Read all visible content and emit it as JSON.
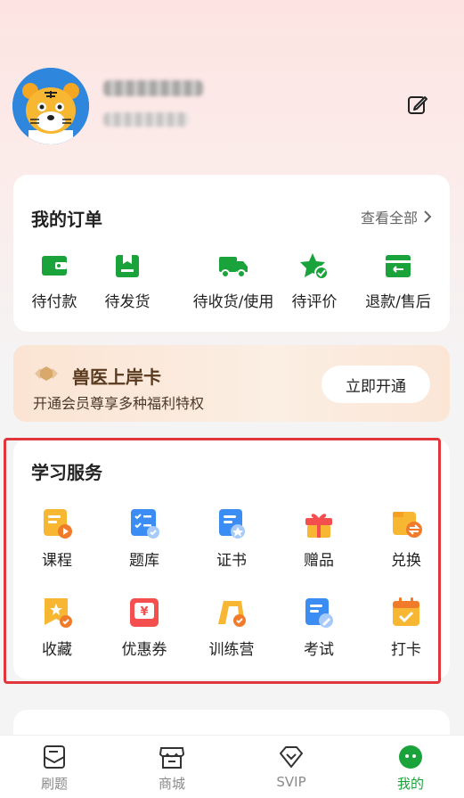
{
  "profile": {},
  "orders": {
    "title": "我的订单",
    "view_all": "查看全部",
    "items": [
      {
        "label": "待付款",
        "icon": "wallet-icon"
      },
      {
        "label": "待发货",
        "icon": "package-icon"
      },
      {
        "label": "待收货/使用",
        "icon": "truck-icon"
      },
      {
        "label": "待评价",
        "icon": "star-check-icon"
      },
      {
        "label": "退款/售后",
        "icon": "refund-icon"
      }
    ]
  },
  "vip": {
    "title": "兽医上岸卡",
    "subtitle": "开通会员尊享多种福利特权",
    "button": "立即开通"
  },
  "study": {
    "title": "学习服务",
    "items": [
      {
        "label": "课程",
        "icon": "course-icon"
      },
      {
        "label": "题库",
        "icon": "question-bank-icon"
      },
      {
        "label": "证书",
        "icon": "certificate-icon"
      },
      {
        "label": "赠品",
        "icon": "gift-icon"
      },
      {
        "label": "兑换",
        "icon": "exchange-icon"
      },
      {
        "label": "收藏",
        "icon": "favorite-icon"
      },
      {
        "label": "优惠券",
        "icon": "coupon-icon"
      },
      {
        "label": "训练营",
        "icon": "training-camp-icon"
      },
      {
        "label": "考试",
        "icon": "exam-icon"
      },
      {
        "label": "打卡",
        "icon": "check-in-icon"
      }
    ]
  },
  "tabs": [
    {
      "label": "刷题",
      "icon": "practice-icon",
      "active": false
    },
    {
      "label": "商城",
      "icon": "store-icon",
      "active": false
    },
    {
      "label": "SVIP",
      "icon": "diamond-icon",
      "active": false
    },
    {
      "label": "我的",
      "icon": "profile-icon",
      "active": true
    }
  ],
  "colors": {
    "accent_green": "#1aa33a",
    "highlight_red": "#e0363c",
    "vip_brown": "#5a3a1e"
  }
}
